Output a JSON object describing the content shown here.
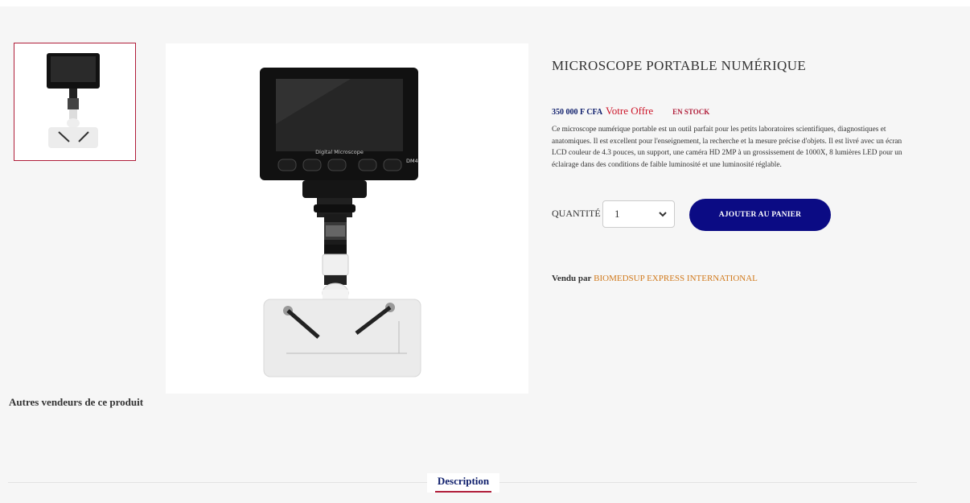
{
  "product": {
    "title": "MICROSCOPE PORTABLE NUMÉRIQUE",
    "price": "350 000 F CFA",
    "offer_label": "Votre Offre",
    "stock_status": "EN STOCK",
    "description": "Ce microscope numérique portable est un outil parfait pour les petits laboratoires scientifiques, diagnostiques et anatomiques. Il est excellent pour l'enseignement, la recherche et la mesure précise d'objets. Il est livré avec un écran LCD couleur de 4.3 pouces, un support, une caméra HD 2MP à un grossissement de 1000X, 8 lumières LED pour un éclairage dans des conditions de faible luminosité et une luminosité réglable.",
    "device_screen_text": "Digital Microscope",
    "device_model": "DM4"
  },
  "quantity": {
    "label": "QUANTITÉ",
    "value": "1"
  },
  "cart_button": "AJOUTER AU PANIER",
  "seller": {
    "label": "Vendu par",
    "name": "BIOMEDSUP EXPRESS INTERNATIONAL"
  },
  "other_sellers_heading": "Autres vendeurs de ce produit",
  "tabs": {
    "description": "Description"
  },
  "colors": {
    "accent_red": "#b01e3a",
    "button_navy": "#0b0b84",
    "seller_link": "#d17a1d"
  }
}
